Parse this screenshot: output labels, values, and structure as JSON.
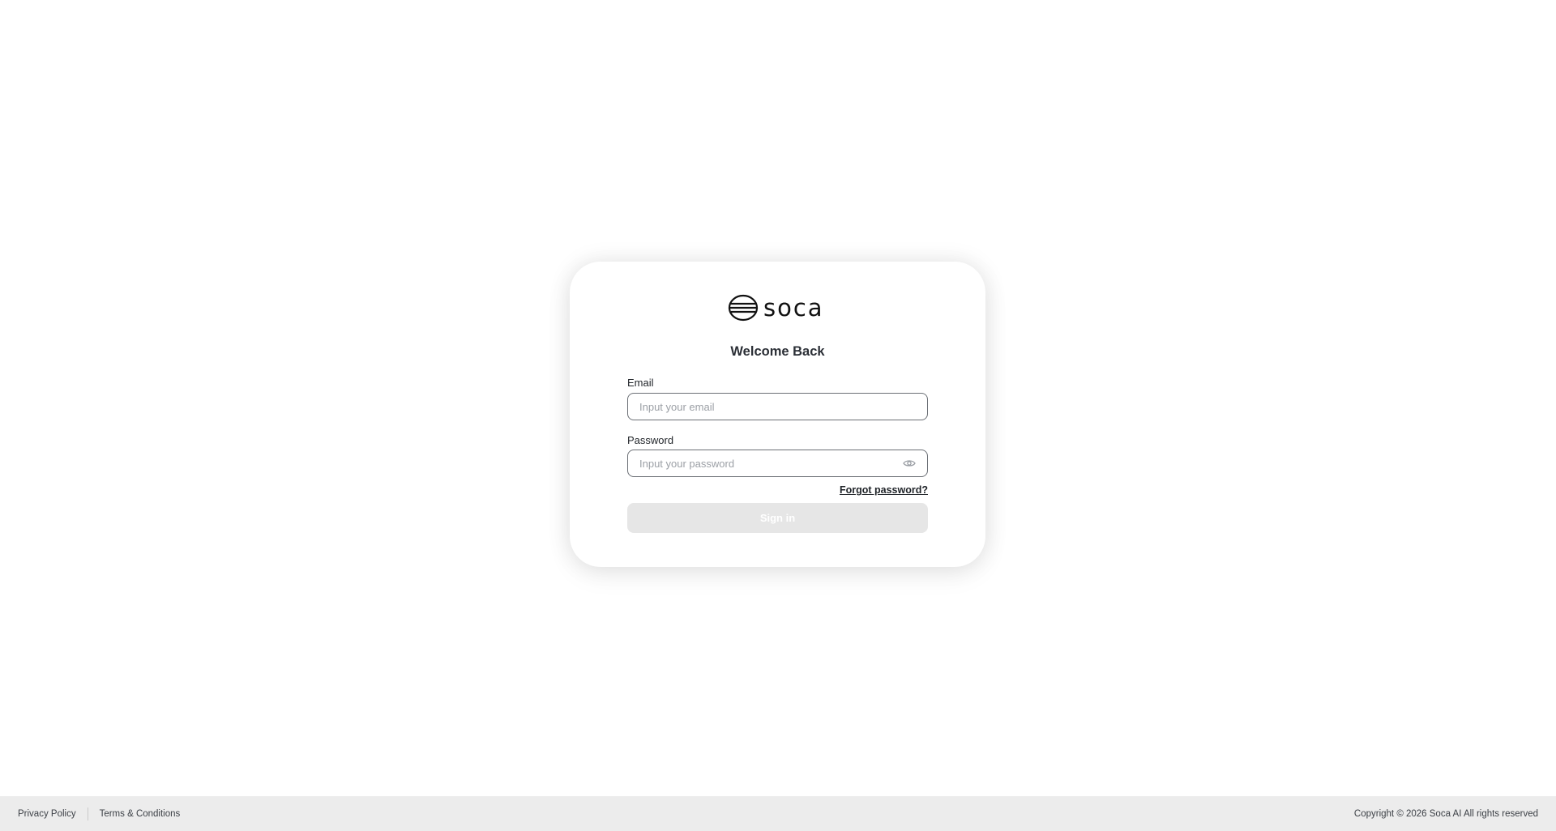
{
  "brand": {
    "name": "soca",
    "logo_icon": "globe-icon"
  },
  "login": {
    "title": "Welcome Back",
    "email_label": "Email",
    "email_placeholder": "Input your email",
    "email_value": "",
    "password_label": "Password",
    "password_placeholder": "Input your password",
    "password_value": "",
    "password_toggle_icon": "eye-icon",
    "forgot_label": "Forgot password?",
    "signin_label": "Sign in"
  },
  "footer": {
    "privacy_label": "Privacy Policy",
    "terms_label": "Terms & Conditions",
    "copyright": "Copyright © 2026 Soca AI All rights reserved"
  },
  "colors": {
    "button_disabled": "#e6e6e6",
    "footer_bg": "#ececec",
    "input_border": "#6b6f75"
  }
}
